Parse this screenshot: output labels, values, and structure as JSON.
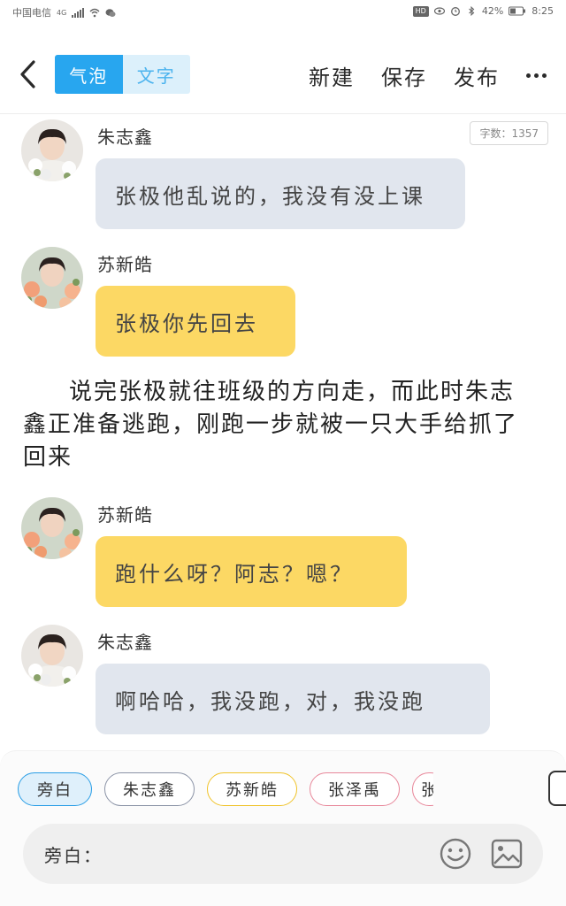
{
  "status_bar": {
    "carrier": "中国电信",
    "network": "4G",
    "hd": "HD",
    "battery": "42%",
    "time": "8:25"
  },
  "header": {
    "mode_tabs": [
      {
        "label": "气泡",
        "active": true
      },
      {
        "label": "文字",
        "active": false
      }
    ],
    "actions": {
      "new": "新建",
      "save": "保存",
      "publish": "发布"
    },
    "icons": {
      "back": "back-arrow-icon",
      "more": "more-dots-icon"
    }
  },
  "word_count": "字数：1357",
  "messages": [
    {
      "sender": "朱志鑫",
      "text": "张极他乱说的，我没有没上课",
      "style": "grey"
    },
    {
      "sender": "苏新皓",
      "text": "张极你先回去",
      "style": "yellow"
    },
    {
      "sender": "苏新皓",
      "text": "跑什么呀？阿志？嗯？",
      "style": "yellow"
    },
    {
      "sender": "朱志鑫",
      "text": "啊哈哈，我没跑，对，我没跑",
      "style": "grey"
    }
  ],
  "narration": "说完张极就往班级的方向走，而此时朱志鑫正准备逃跑，刚跑一步就被一只大手给抓了回来",
  "characters": [
    {
      "label": "旁白",
      "color": "#2a9ee6",
      "selected": true
    },
    {
      "label": "朱志鑫",
      "color": "#8b93a6"
    },
    {
      "label": "苏新皓",
      "color": "#f0c32a"
    },
    {
      "label": "张泽禹",
      "color": "#e8879a"
    },
    {
      "label": "张",
      "color": "#e8879a"
    }
  ],
  "input": {
    "label": "旁白：",
    "emoji_icon": "smiley-icon",
    "image_icon": "image-icon"
  },
  "colors": {
    "accent": "#28a6ef",
    "bubble_grey": "#e1e6ee",
    "bubble_yellow": "#fcd864"
  }
}
